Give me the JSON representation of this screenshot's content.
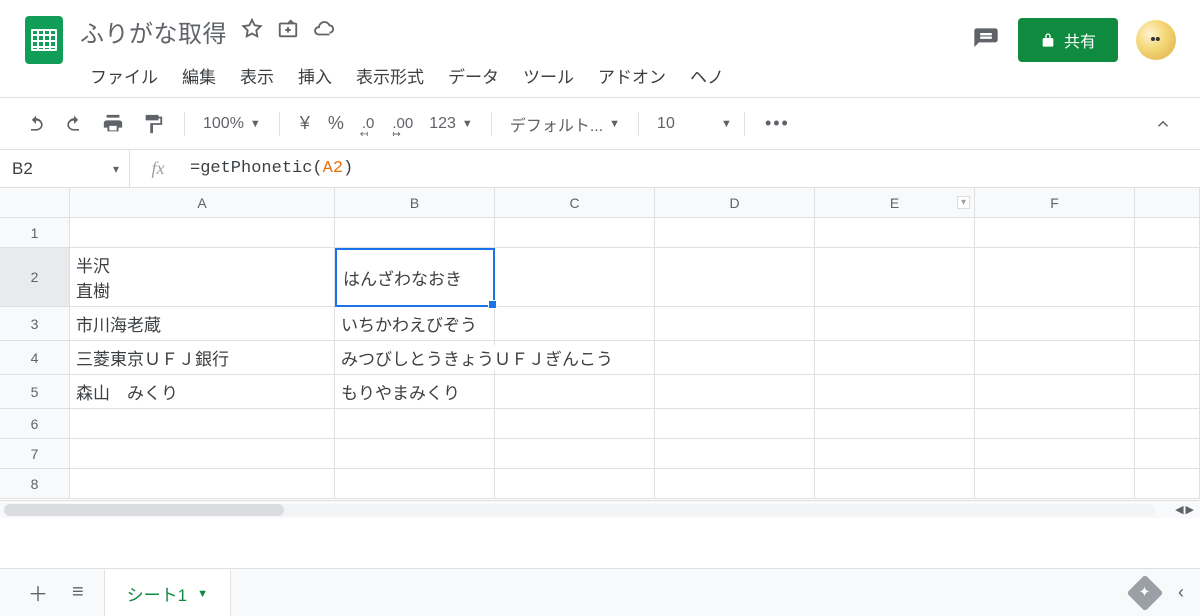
{
  "doc": {
    "title": "ふりがな取得"
  },
  "menu": [
    "ファイル",
    "編集",
    "表示",
    "挿入",
    "表示形式",
    "データ",
    "ツール",
    "アドオン",
    "ヘノ"
  ],
  "share": {
    "label": "共有"
  },
  "toolbar": {
    "zoom": "100%",
    "currency": "¥",
    "percent": "%",
    "dec_dec": ".0",
    "dec_inc": ".00",
    "more_fmt": "123",
    "font": "デフォルト...",
    "font_size": "10",
    "more": "•••"
  },
  "formula": {
    "name_box": "B2",
    "fx": "fx",
    "prefix": "=getPhonetic(",
    "ref": "A2",
    "suffix": ")"
  },
  "cols": [
    "A",
    "B",
    "C",
    "D",
    "E",
    "F",
    ""
  ],
  "rows": [
    {
      "n": "1",
      "a": "",
      "b": ""
    },
    {
      "n": "2",
      "a": "半沢\n直樹",
      "b": "はんざわなおき"
    },
    {
      "n": "3",
      "a": "市川海老蔵",
      "b": "いちかわえびぞう"
    },
    {
      "n": "4",
      "a": "三菱東京ＵＦＪ銀行",
      "b": "みつびしとうきょうＵＦＪぎんこう"
    },
    {
      "n": "5",
      "a": "森山　みくり",
      "b": "もりやまみくり"
    },
    {
      "n": "6",
      "a": "",
      "b": ""
    },
    {
      "n": "7",
      "a": "",
      "b": ""
    },
    {
      "n": "8",
      "a": "",
      "b": ""
    }
  ],
  "sheet": {
    "name": "シート1"
  }
}
